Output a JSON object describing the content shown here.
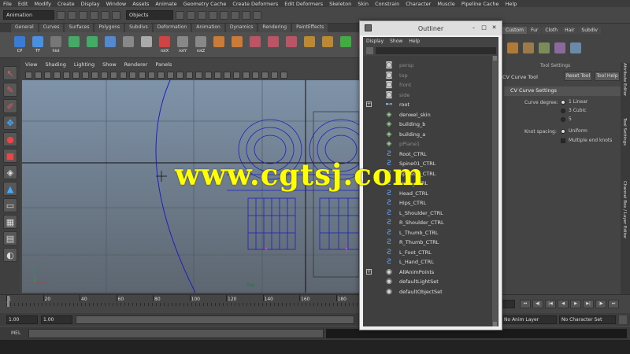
{
  "menubar": [
    "File",
    "Edit",
    "Modify",
    "Create",
    "Display",
    "Window",
    "Assets",
    "Animate",
    "Geometry Cache",
    "Create Deformers",
    "Edit Deformers",
    "Skeleton",
    "Skin",
    "Constrain",
    "Character",
    "Muscle",
    "Pipeline Cache",
    "Help"
  ],
  "status": {
    "mode": "Animation",
    "objects_field": "Objects"
  },
  "shelf_tabs": [
    "General",
    "Curves",
    "Surfaces",
    "Polygons",
    "Subdivs",
    "Deformation",
    "Animation",
    "Dynamics",
    "Rendering",
    "PaintEffects"
  ],
  "shelf_icons": [
    {
      "label": "CP",
      "color": "#3a7bd5"
    },
    {
      "label": "TF",
      "color": "#4a90e2"
    },
    {
      "label": "hist",
      "color": "#777777"
    },
    {
      "label": "",
      "color": "#44aa66"
    },
    {
      "label": "",
      "color": "#44aa66"
    },
    {
      "label": "",
      "color": "#5588cc"
    },
    {
      "label": "",
      "color": "#888888"
    },
    {
      "label": "",
      "color": "#aaaaaa"
    },
    {
      "label": "rotX",
      "color": "#cc4444"
    },
    {
      "label": "rotY",
      "color": "#888888"
    },
    {
      "label": "rotZ",
      "color": "#888888"
    },
    {
      "label": "",
      "color": "#c97b3a"
    },
    {
      "label": "",
      "color": "#c97b3a"
    },
    {
      "label": "",
      "color": "#bb5566"
    },
    {
      "label": "",
      "color": "#bb5566"
    },
    {
      "label": "",
      "color": "#bb5566"
    },
    {
      "label": "",
      "color": "#bb8833"
    },
    {
      "label": "",
      "color": "#bb8833"
    },
    {
      "label": "",
      "color": "#44aa44"
    },
    {
      "label": "Rena",
      "color": "#aa3344"
    },
    {
      "label": "",
      "color": "#cc9933"
    },
    {
      "label": "",
      "color": "#cc4444"
    }
  ],
  "panel_menu": [
    "View",
    "Shading",
    "Lighting",
    "Show",
    "Renderer",
    "Panels"
  ],
  "viewport": {
    "label": "top",
    "axis_y": "y",
    "axis_x": "x"
  },
  "timeline": {
    "ticks": [
      "1",
      "20",
      "40",
      "60",
      "80",
      "100",
      "120",
      "140",
      "160",
      "180"
    ]
  },
  "range": {
    "start": "1.00",
    "current": "1.00"
  },
  "cmd": {
    "label": "MEL"
  },
  "right_panel": {
    "tabs": [
      "Custom",
      "Fur",
      "Cloth",
      "Hair",
      "Subdiv"
    ],
    "tool_settings_title": "Tool Settings",
    "tool_name": "CV Curve Tool",
    "reset_button": "Reset Tool",
    "tool_help": "Tool Help",
    "section_title": "CV Curve Settings",
    "curve_degree_label": "Curve degree:",
    "degree_options": [
      "1 Linear",
      "3 Cubic",
      "5"
    ],
    "knot_label": "Knot spacing:",
    "knot_options": [
      "Uniform",
      "Multiple end knots"
    ],
    "side_tabs": [
      "Attribute Editor",
      "Tool Settings",
      "Channel Box / Layer Editor"
    ],
    "anim_layer": "No Anim Layer",
    "char_set": "No Character Set"
  },
  "outliner": {
    "title": "Outliner",
    "menu": [
      "Display",
      "Show",
      "Help"
    ],
    "rows": [
      {
        "name": "persp",
        "icon": "camera-icon",
        "dim": true,
        "expander": ""
      },
      {
        "name": "top",
        "icon": "camera-icon",
        "dim": true,
        "expander": ""
      },
      {
        "name": "front",
        "icon": "camera-icon",
        "dim": true,
        "expander": ""
      },
      {
        "name": "side",
        "icon": "camera-icon",
        "dim": true,
        "expander": ""
      },
      {
        "name": "root",
        "icon": "joint-icon",
        "dim": false,
        "expander": "+"
      },
      {
        "name": "denwel_skin",
        "icon": "mesh-icon",
        "dim": false,
        "expander": ""
      },
      {
        "name": "building_b",
        "icon": "mesh-icon",
        "dim": false,
        "expander": ""
      },
      {
        "name": "building_a",
        "icon": "mesh-icon",
        "dim": false,
        "expander": ""
      },
      {
        "name": "pPlane1",
        "icon": "mesh-icon",
        "dim": true,
        "expander": ""
      },
      {
        "name": "Root_CTRL",
        "icon": "curve-icon",
        "dim": false,
        "expander": ""
      },
      {
        "name": "Spine01_CTRL",
        "icon": "curve-icon",
        "dim": false,
        "expander": ""
      },
      {
        "name": "Spine02_CTRL",
        "icon": "curve-icon",
        "dim": false,
        "expander": ""
      },
      {
        "name": "Neck_CTRL",
        "icon": "curve-icon",
        "dim": false,
        "expander": ""
      },
      {
        "name": "Head_CTRL",
        "icon": "curve-icon",
        "dim": false,
        "expander": ""
      },
      {
        "name": "Hips_CTRL",
        "icon": "curve-icon",
        "dim": false,
        "expander": ""
      },
      {
        "name": "L_Shoulder_CTRL",
        "icon": "curve-icon",
        "dim": false,
        "expander": ""
      },
      {
        "name": "R_Shoulder_CTRL",
        "icon": "curve-icon",
        "dim": false,
        "expander": ""
      },
      {
        "name": "L_Thumb_CTRL",
        "icon": "curve-icon",
        "dim": false,
        "expander": ""
      },
      {
        "name": "R_Thumb_CTRL",
        "icon": "curve-icon",
        "dim": false,
        "expander": ""
      },
      {
        "name": "L_Foot_CTRL",
        "icon": "curve-icon",
        "dim": false,
        "expander": ""
      },
      {
        "name": "L_Hand_CTRL",
        "icon": "curve-icon",
        "dim": false,
        "expander": ""
      },
      {
        "name": "AllAnimPoints",
        "icon": "set-icon",
        "dim": false,
        "expander": "+"
      },
      {
        "name": "defaultLightSet",
        "icon": "set-icon",
        "dim": false,
        "expander": ""
      },
      {
        "name": "defaultObjectSet",
        "icon": "set-icon",
        "dim": false,
        "expander": ""
      }
    ]
  },
  "watermark": "www.cgtsj.com",
  "colors": {
    "watermark": "#ffff00",
    "wire": "#1c1fbf",
    "viewport_top": "#7f93a9",
    "viewport_bottom": "#5d6670"
  }
}
